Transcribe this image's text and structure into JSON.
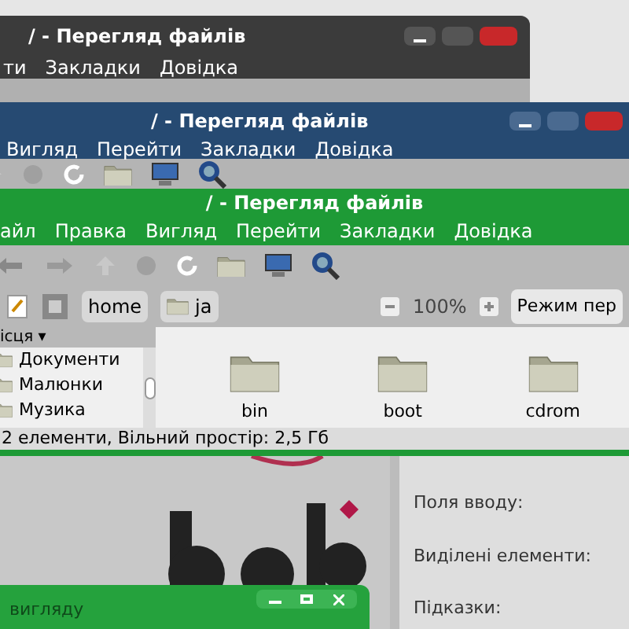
{
  "windows": [
    {
      "title": "/ - Перегляд файлів",
      "menu": [
        "ти",
        "Закладки",
        "Довідка"
      ]
    },
    {
      "title": "/ - Перегляд файлів",
      "menu": [
        "Вигляд",
        "Перейти",
        "Закладки",
        "Довідка"
      ]
    },
    {
      "title": "/ - Перегляд файлів",
      "menu": [
        "айл",
        "Правка",
        "Вигляд",
        "Перейти",
        "Закладки",
        "Довідка"
      ],
      "path": [
        "home",
        "ja"
      ],
      "zoom": "100%",
      "view_mode": "Режим пер",
      "sidebar": {
        "header": "ісця ▾",
        "items": [
          "Документи",
          "Малюнки",
          "Музика"
        ]
      },
      "files": [
        "bin",
        "boot",
        "cdrom"
      ],
      "status": "2 елементи, Вільний простір: 2,5 Гб"
    }
  ],
  "settings_panel": {
    "labels": [
      "Поля вводу:",
      "Виділені елементи:",
      "Підказки:"
    ]
  },
  "small_window": {
    "title": "вигляду"
  }
}
